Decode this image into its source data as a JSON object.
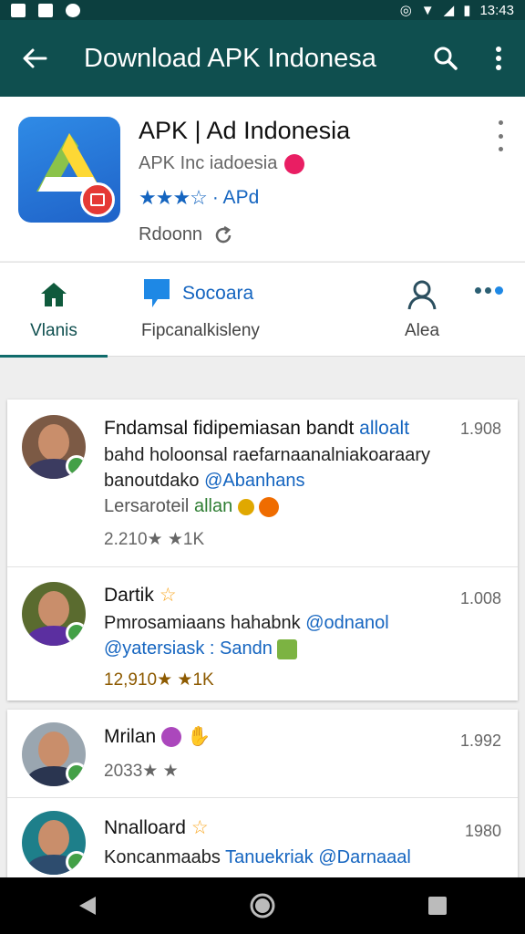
{
  "status": {
    "time": "13:43"
  },
  "toolbar": {
    "title": "Download APK Indonesa"
  },
  "app": {
    "name": "APK | Ad Indonesia",
    "subtitle": "APK Inc iadoesia",
    "rating_stars": "★★★☆",
    "rating_text": "· APd",
    "review_label": "Rdoonn"
  },
  "tabs": [
    {
      "label": "Vlanis"
    },
    {
      "title": "Socoara",
      "label": "Fipcanalkisleny"
    },
    {
      "label": "Alea"
    }
  ],
  "posts": [
    {
      "line1": "Fndamsal fidipemiasan bandt",
      "line1_hl": "alloalt",
      "time": "1.908",
      "line2": "bahd holoonsal raefarnaanalniakoaraary",
      "line3": "banoutdako",
      "line3_hl": "@Abanhans",
      "line4": "Lersaroteil",
      "line4_hl": "allan",
      "stats": "2.210★  ★1K"
    },
    {
      "name": "Dartik",
      "time": "1.008",
      "line1": "Pmrosamiaans hahabnk",
      "line1_hl": "@odnanol",
      "line2": "@yatersiask : Sandn",
      "stats": "12,910★  ★1K"
    },
    {
      "name": "Mrilan",
      "time": "1.992",
      "stats": "2033★  ★"
    },
    {
      "name": "Nnalloard",
      "time": "1980",
      "line1": "Koncanmaabs",
      "line1_hl": "Tanuekriak @Darnaaal"
    }
  ],
  "colors": {
    "toolbar": "#0f4f4f",
    "accent": "#1565c0",
    "online": "#43a047"
  }
}
